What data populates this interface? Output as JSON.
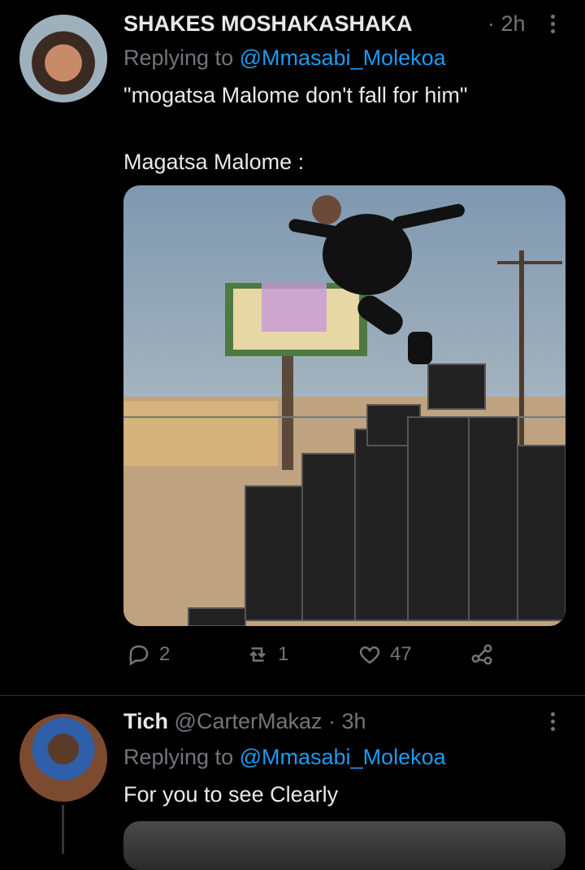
{
  "tweet1": {
    "display_name": "SHAKES MOSHAKASHAKA",
    "time": "· 2h",
    "replying_prefix": "Replying to",
    "replying_to": "@Mmasabi_Molekoa",
    "text_line1": "\"mogatsa Malome don't fall for him\"",
    "text_line2": "Magatsa Malome :",
    "actions": {
      "replies": "2",
      "retweets": "1",
      "likes": "47"
    }
  },
  "tweet2": {
    "display_name": "Tich",
    "handle": "@CarterMakaz",
    "time": "· 3h",
    "replying_prefix": "Replying to",
    "replying_to": "@Mmasabi_Molekoa",
    "text": "For you to see Clearly"
  },
  "icons": [
    "more-icon",
    "reply-icon",
    "retweet-icon",
    "like-icon",
    "share-icon"
  ],
  "colors": {
    "background": "#000000",
    "link": "#1d9bf0",
    "muted": "#71767b",
    "text": "#e7e9ea"
  }
}
